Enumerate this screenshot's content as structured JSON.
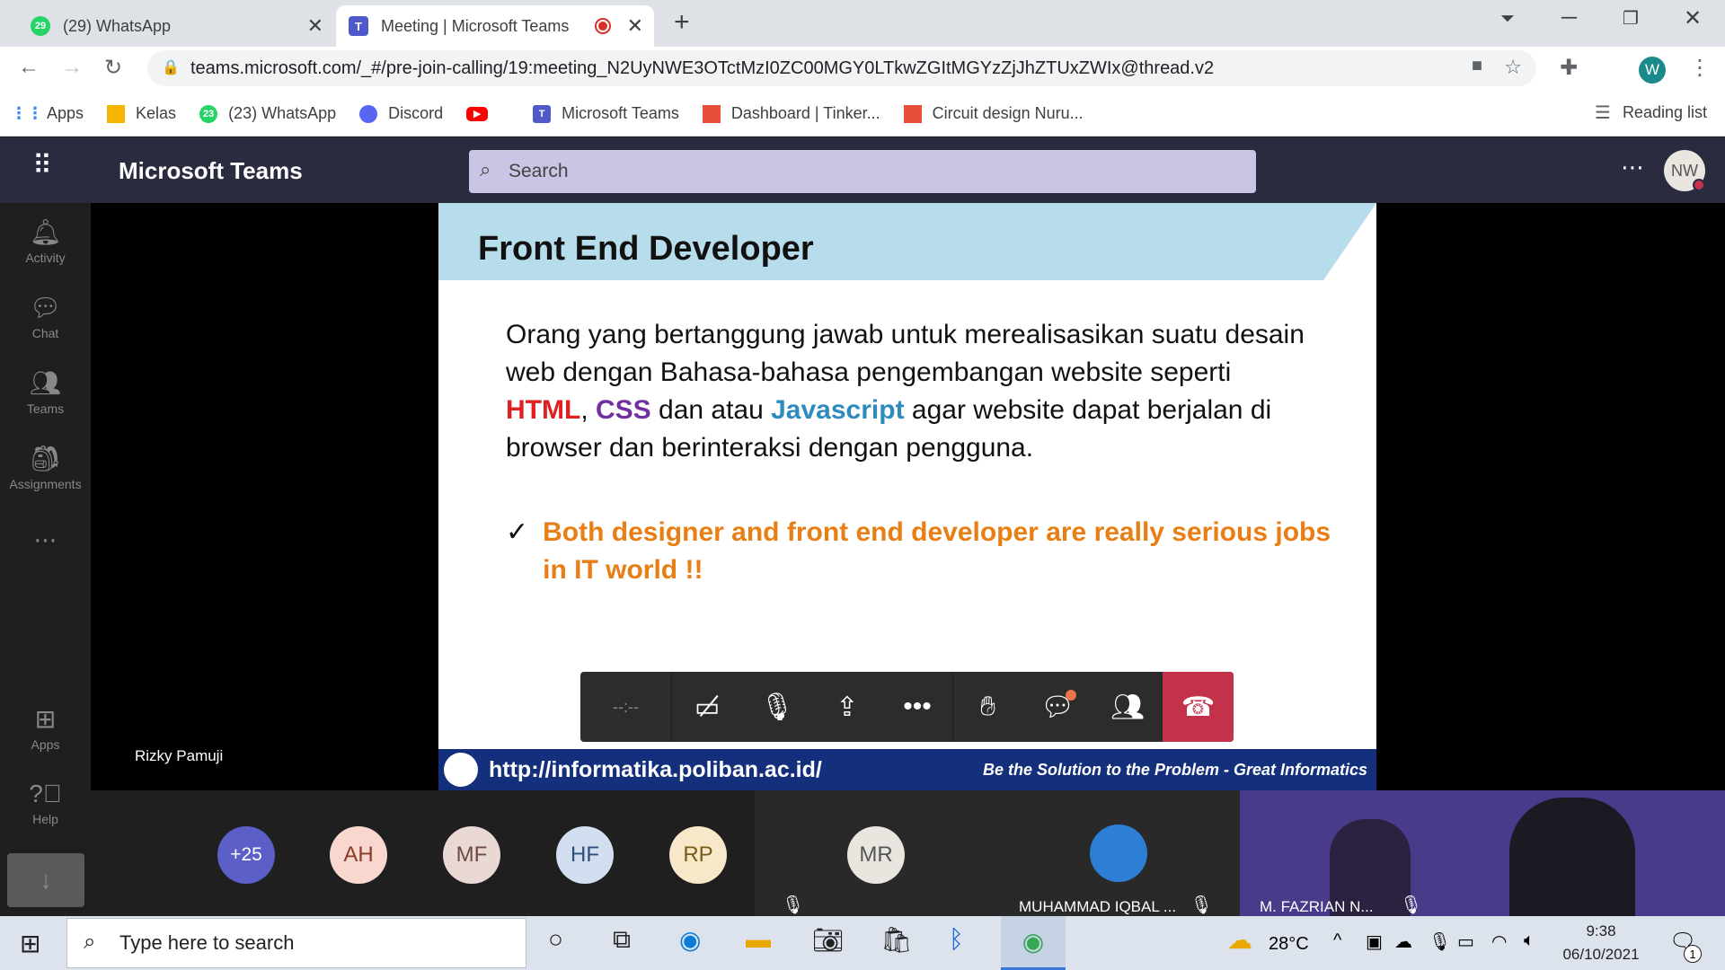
{
  "browser": {
    "tabs": [
      {
        "title": "(29) WhatsApp",
        "badge": "29"
      },
      {
        "title": "Meeting | Microsoft Teams"
      }
    ],
    "url": "teams.microsoft.com/_#/pre-join-calling/19:meeting_N2UyNWE3OTctMzI0ZC00MGY0LTkwZGItMGYzZjJhZTUxZWIx@thread.v2",
    "profile_initial": "W",
    "bookmarks": [
      "Apps",
      "Kelas",
      "(23) WhatsApp",
      "Discord",
      "Microsoft Teams",
      "Dashboard | Tinker...",
      "Circuit design Nuru..."
    ],
    "bookmark_badge": "23",
    "reading_list": "Reading list"
  },
  "teams": {
    "app_title": "Microsoft Teams",
    "search_placeholder": "Search",
    "user_initials": "NW",
    "rail": [
      "Activity",
      "Chat",
      "Teams",
      "Assignments",
      "Apps",
      "Help"
    ]
  },
  "slide": {
    "title": "Front End Developer",
    "body_part1": "Orang yang bertanggung jawab untuk merealisasikan suatu desain web dengan  Bahasa-bahasa pengembangan website seperti ",
    "html": "HTML",
    "comma": ", ",
    "css": "CSS",
    "and": " dan atau ",
    "js": "Javascript",
    "body_part2": " agar website dapat berjalan di browser dan berinteraksi dengan pengguna.",
    "point": "Both designer and front end developer are really serious jobs in IT world !!",
    "footer_url": "http://informatika.poliban.ac.id/",
    "footer_motto": "Be the Solution to the Problem - Great Informatics"
  },
  "meeting": {
    "presenter_name": "Rizky Pamuji",
    "timer": "--:--",
    "overflow_count": "+25",
    "avatars": [
      {
        "initials": "AH",
        "bg": "#f8d7cf",
        "fg": "#8a3b2a"
      },
      {
        "initials": "MF",
        "bg": "#ead8d4",
        "fg": "#6b4a42"
      },
      {
        "initials": "HF",
        "bg": "#d3dff0",
        "fg": "#2f4f7a"
      },
      {
        "initials": "RP",
        "bg": "#f6e8c8",
        "fg": "#7a5a1a"
      }
    ],
    "tiles": [
      {
        "initials": "MR",
        "name": ""
      },
      {
        "initials": "",
        "name": "MUHAMMAD IQBAL ..."
      },
      {
        "initials": "",
        "name": "M. FAZRIAN N..."
      }
    ],
    "colors": {
      "hangup": "#c4314b",
      "teams_bar": "#2b2b40",
      "overflow": "#5b5fc7"
    }
  },
  "taskbar": {
    "search_placeholder": "Type here to search",
    "weather": "28°C",
    "time": "9:38",
    "date": "06/10/2021",
    "notif_count": "1"
  }
}
